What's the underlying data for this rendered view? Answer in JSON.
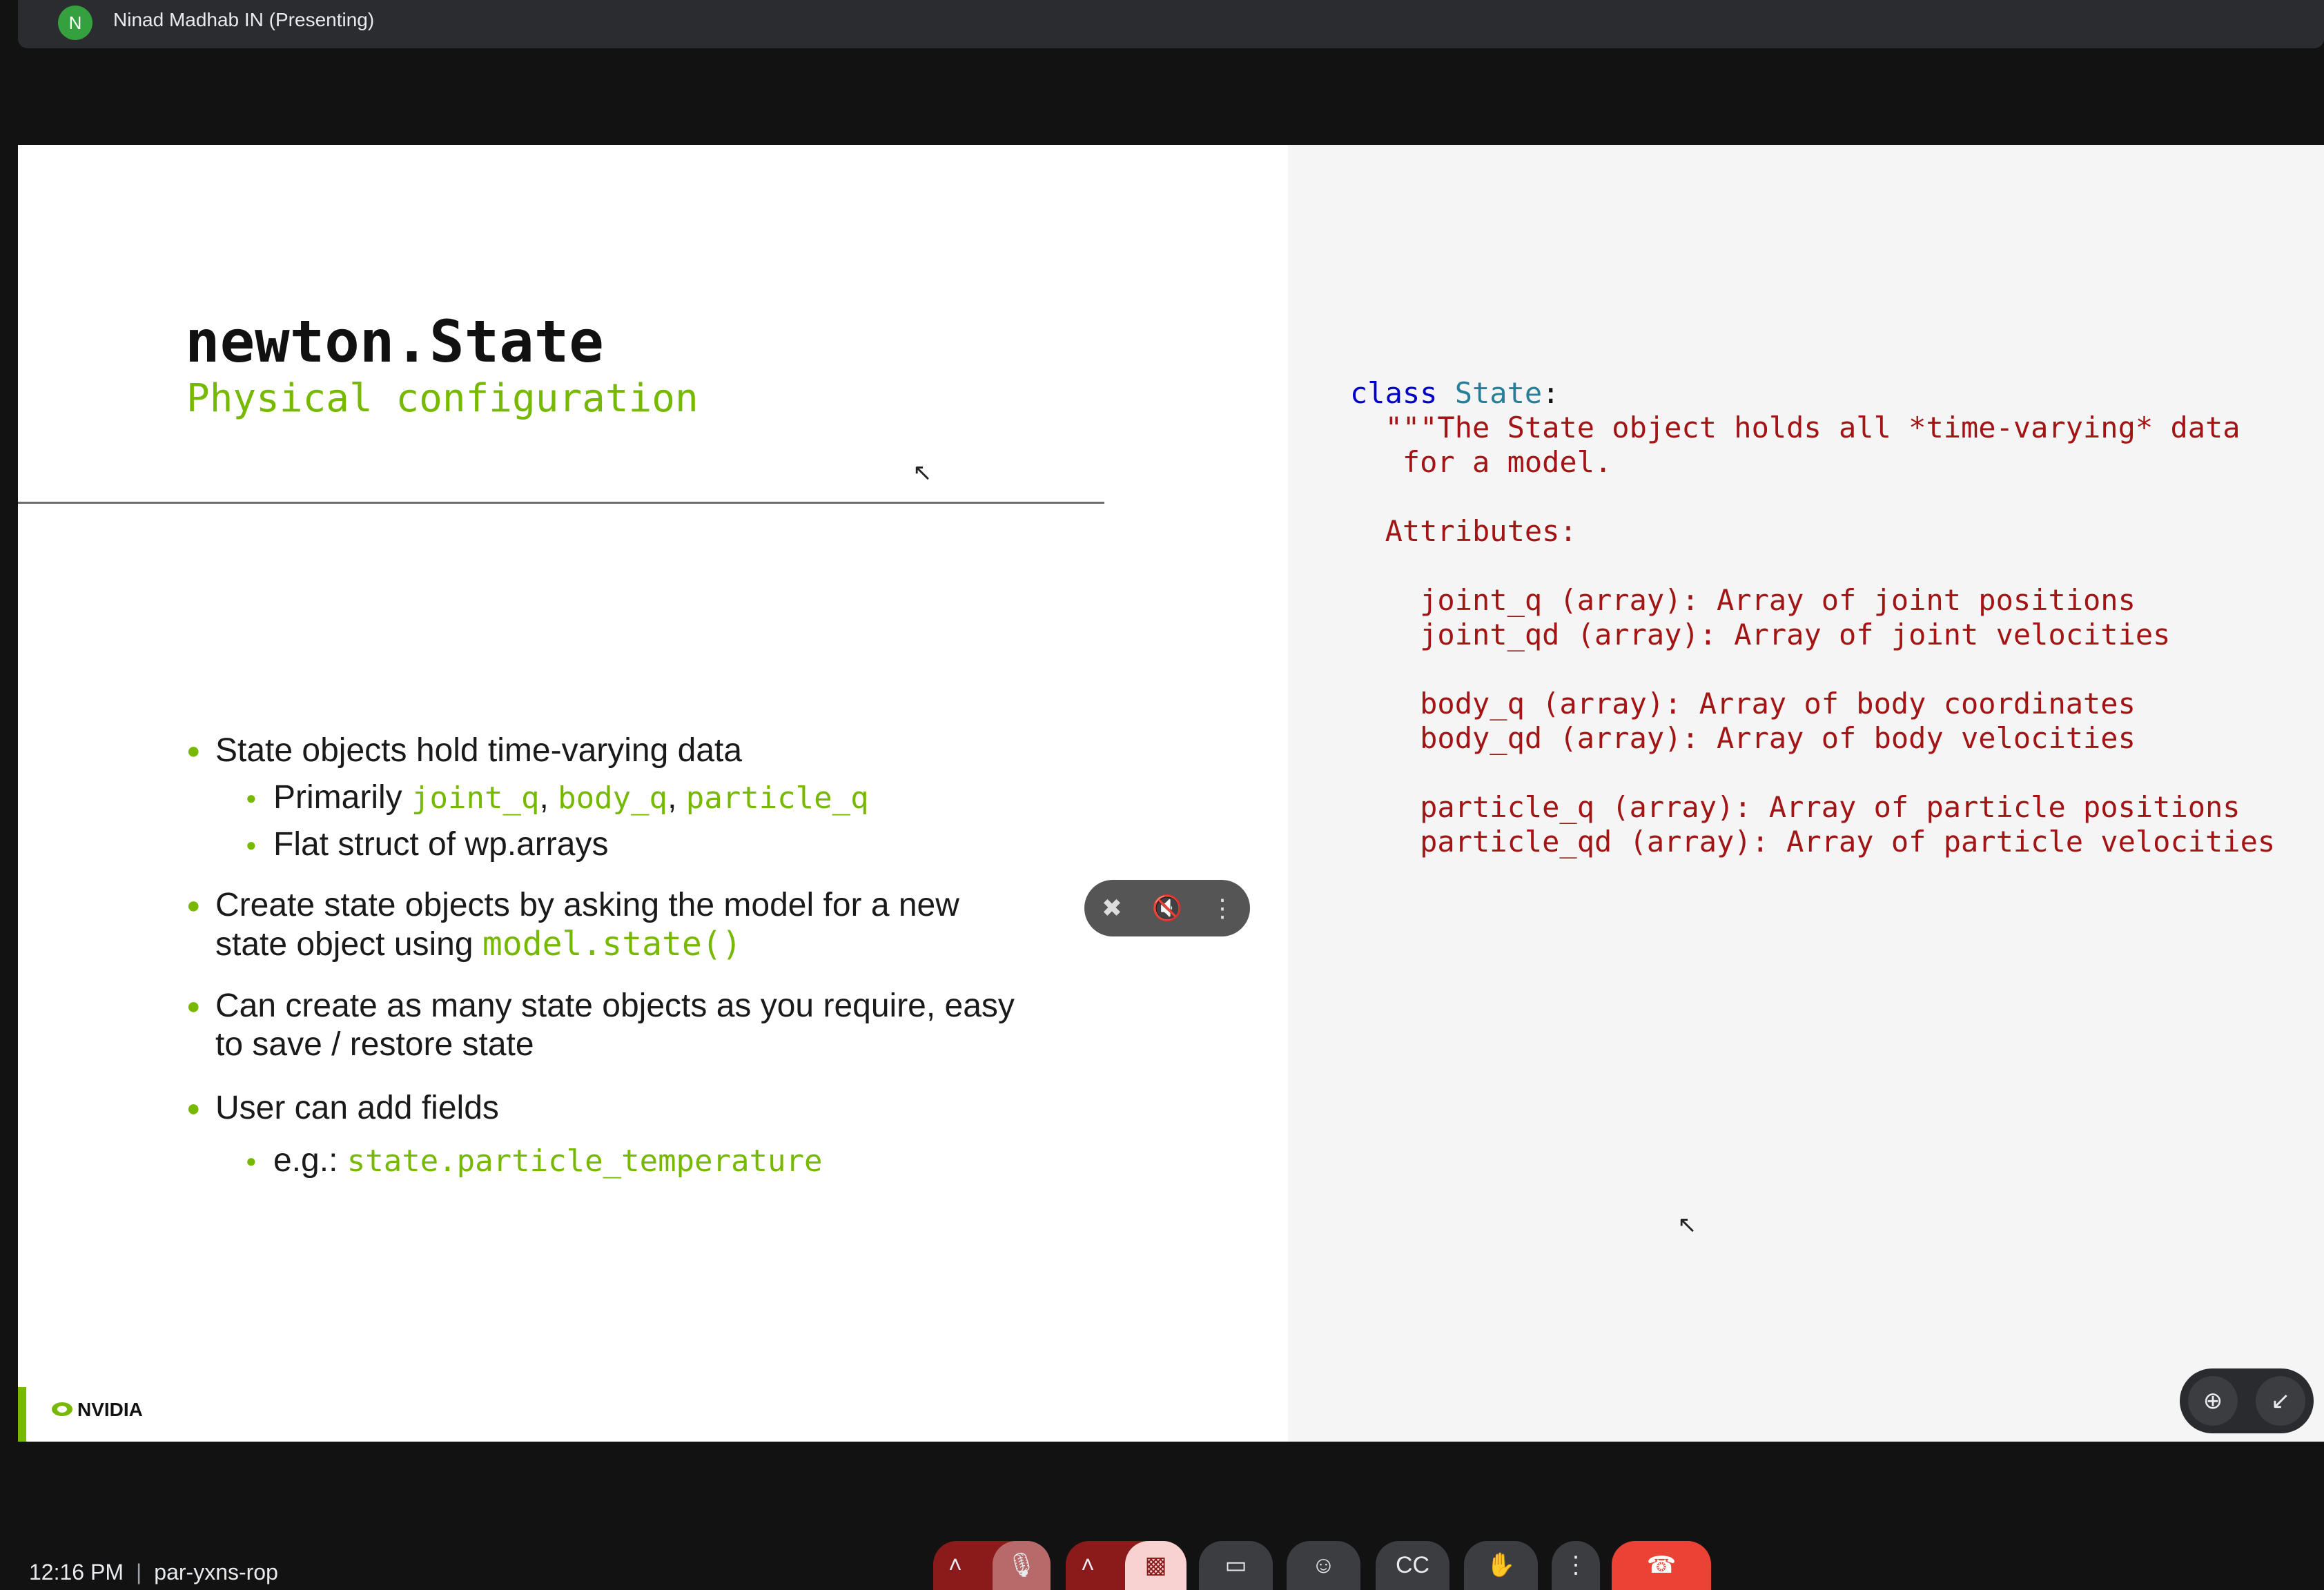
{
  "meeting": {
    "avatar_initial": "N",
    "presenter_label": "Ninad Madhab IN (Presenting)",
    "time": "12:16 PM",
    "meeting_code": "par-yxns-rop"
  },
  "slide": {
    "title": "newton.State",
    "subtitle": "Physical configuration",
    "logo_text": "NVIDIA",
    "bullets": {
      "b1": "State objects hold time-varying data",
      "b1_sub1_prefix": "Primarily ",
      "b1_sub1_code1": "joint_q",
      "b1_sub1_sep1": ", ",
      "b1_sub1_code2": "body_q",
      "b1_sub1_sep2": ", ",
      "b1_sub1_code3": "particle_q",
      "b1_sub2": "Flat struct of wp.arrays",
      "b2_line1": "Create state objects by asking the model for a new",
      "b2_line2_prefix": "state object using ",
      "b2_line2_code": "model.state()",
      "b3_line1": "Can create as many state objects as you require, easy",
      "b3_line2": "to save / restore state",
      "b4": "User can add fields",
      "b4_sub1_prefix": "e.g.: ",
      "b4_sub1_code": "state.particle_temperature"
    },
    "code": {
      "kw_class": "class",
      "class_name": "State",
      "colon": ":",
      "line2": "  \"\"\"The State object holds all *time-varying* data",
      "line3": "   for a model.",
      "line5": "  Attributes:",
      "line7": "    joint_q (array): Array of joint positions",
      "line8": "    joint_qd (array): Array of joint velocities",
      "line10": "    body_q (array): Array of body coordinates",
      "line11": "    body_qd (array): Array of body velocities",
      "line13": "    particle_q (array): Array of particle positions",
      "line14": "    particle_qd (array): Array of particle velocities"
    }
  },
  "colors": {
    "nvidia_green": "#76b900",
    "code_string": "#a31515",
    "keyword": "#0000cc",
    "class_name": "#267f99",
    "hangup_red": "#ea4335"
  },
  "icons": {
    "pin_off": "pin-off-icon",
    "mute": "volume-off-icon",
    "more": "more-vert-icon",
    "zoom": "zoom-in-icon",
    "minimize": "minimize-icon",
    "mic_off": "mic-off-icon",
    "cam_off": "videocam-off-icon",
    "present": "present-screen-icon",
    "emoji": "emoji-icon",
    "captions": "captions-icon",
    "hand": "raise-hand-icon",
    "hangup": "call-end-icon"
  }
}
